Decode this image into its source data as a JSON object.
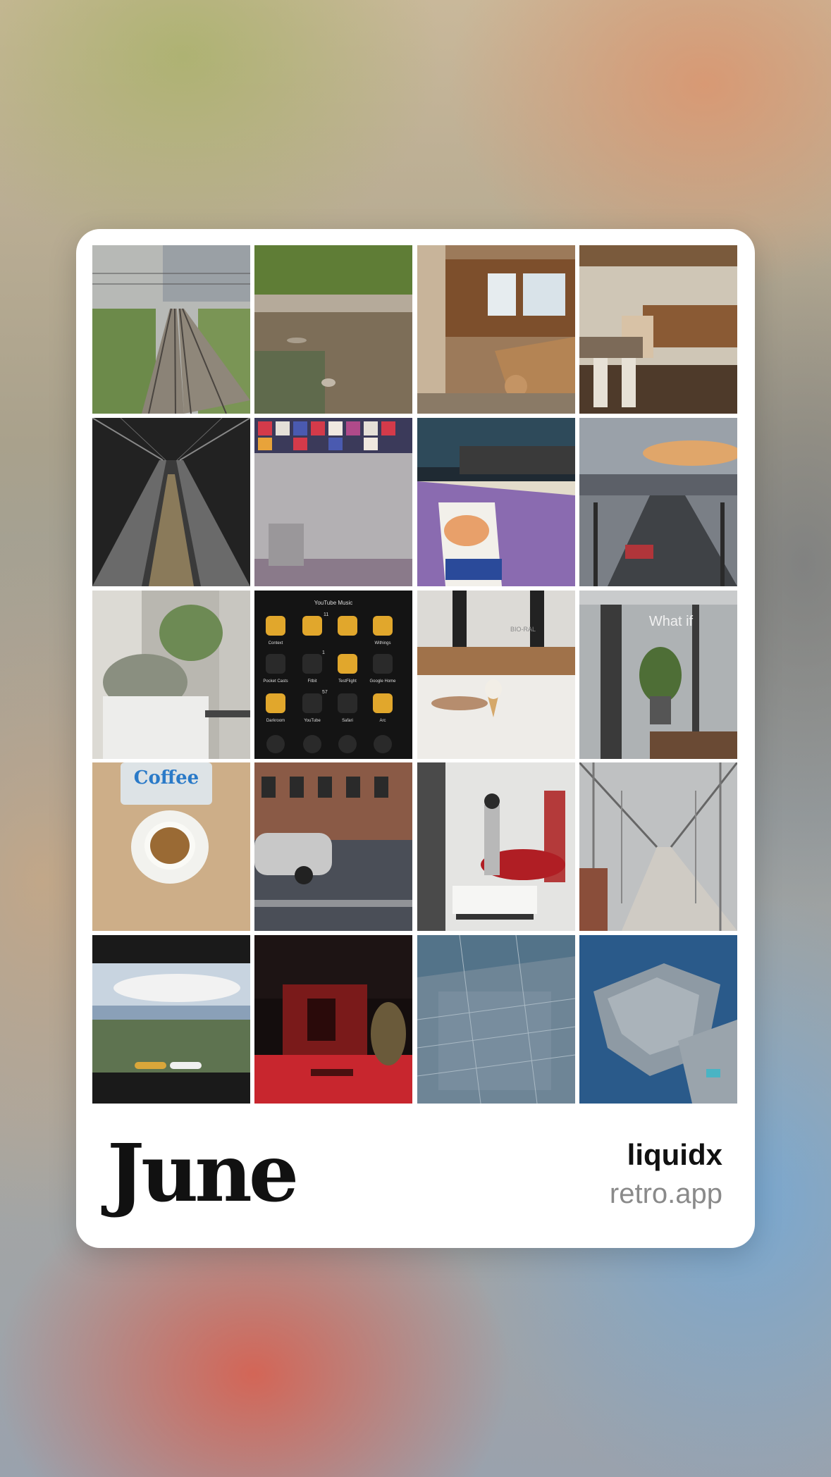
{
  "card": {
    "month": "June",
    "username": "liquidx",
    "app": "retro.app"
  },
  "photos": [
    {
      "name": "railway-tracks"
    },
    {
      "name": "river-bank"
    },
    {
      "name": "cafe-counter"
    },
    {
      "name": "vintage-lounge"
    },
    {
      "name": "escalator-tunnel"
    },
    {
      "name": "colorful-ceiling-hall"
    },
    {
      "name": "shaved-ice-counter"
    },
    {
      "name": "sunset-street"
    },
    {
      "name": "succulent-pot"
    },
    {
      "name": "phone-home-screen",
      "app_labels": [
        "YouTube Music",
        "Context",
        "Withings",
        "Pocket Casts",
        "Fitbit",
        "TestFlight",
        "Google Home",
        "Darkroom",
        "YouTube",
        "Safari",
        "Arc"
      ],
      "badges": [
        "11",
        "1",
        "57"
      ]
    },
    {
      "name": "ice-cream-cone",
      "sign_text": "BIO-RAL"
    },
    {
      "name": "glass-storefront",
      "sign_text": "What if"
    },
    {
      "name": "coffee-cup",
      "bag_text": "Coffee"
    },
    {
      "name": "city-street-car"
    },
    {
      "name": "robot-showroom"
    },
    {
      "name": "scaffolding-walkway"
    },
    {
      "name": "airplane-window-view"
    },
    {
      "name": "red-lit-storefront"
    },
    {
      "name": "aerial-city"
    },
    {
      "name": "aerial-island"
    }
  ]
}
